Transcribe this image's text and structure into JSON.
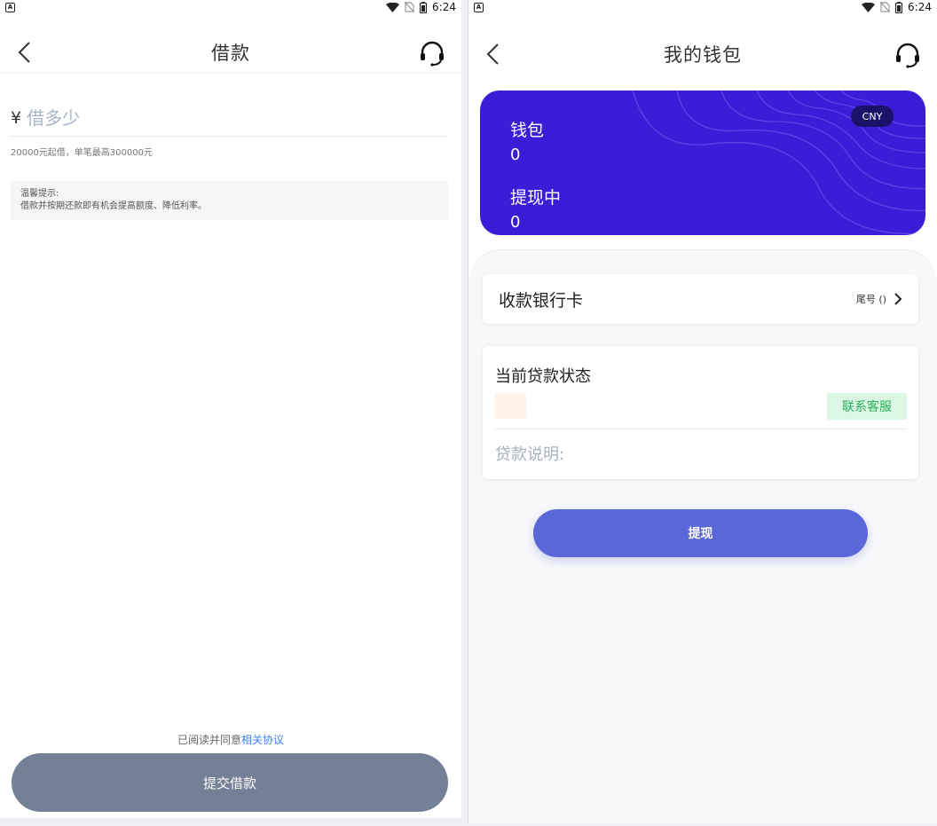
{
  "status_bar": {
    "time": "6:24",
    "icons": [
      "notification-a-icon",
      "wifi-icon",
      "no-sim-icon",
      "battery-icon"
    ]
  },
  "loan_screen": {
    "title": "借款",
    "currency_symbol": "¥",
    "amount_placeholder": "借多少",
    "amount_value": "",
    "amount_hint": "20000元起借，单笔最高300000元",
    "tip_title": "温馨提示:",
    "tip_text": "借款并按期还款即有机会提高额度、降低利率。",
    "agree_prefix": "已阅读并同意",
    "agree_link": "相关协议",
    "submit_label": "提交借款"
  },
  "wallet_screen": {
    "title": "我的钱包",
    "card": {
      "currency_badge": "CNY",
      "wallet_label": "钱包",
      "wallet_value": "0",
      "withdrawing_label": "提现中",
      "withdrawing_value": "0"
    },
    "bank_card_label": "收款银行卡",
    "bank_card_tail": "尾号 ()",
    "loan_status_title": "当前贷款状态",
    "contact_label": "联系客服",
    "loan_desc_label": "贷款说明:",
    "withdraw_label": "提现"
  },
  "colors": {
    "card_bg": "#3c1cd6",
    "submit_bg": "#738096",
    "withdraw_bg": "#5b67d9",
    "contact_bg": "#dcf7e3",
    "contact_text": "#28b15c",
    "link": "#3b82f6"
  }
}
